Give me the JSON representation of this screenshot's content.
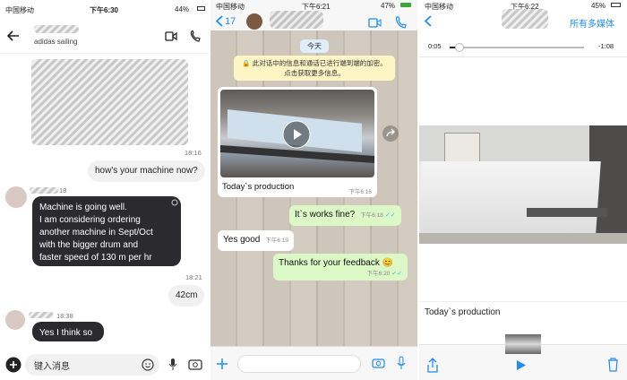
{
  "left": {
    "status": {
      "carrier": "中国移动",
      "time": "下午6:30",
      "battery": "44%"
    },
    "header": {
      "subtitle": "adidas sailing"
    },
    "messages": [
      {
        "time": "18:16"
      },
      {
        "text": "how's your machine now?"
      },
      {
        "time": "18"
      },
      {
        "lines": [
          "Machine is going well.",
          "I am considering ordering",
          "another machine in Sept/Oct",
          "with the bigger drum and",
          "faster speed of 130 m per hr"
        ]
      },
      {
        "time": "18:21"
      },
      {
        "text": "42cm"
      },
      {
        "time": "18:38"
      },
      {
        "text": "Yes I think so"
      }
    ],
    "input_placeholder": "键入消息"
  },
  "middle": {
    "status": {
      "carrier": "中国移动",
      "time": "下午6:21",
      "battery": "47%"
    },
    "header": {
      "back_count": "17"
    },
    "date_label": "今天",
    "encryption_notice": "此对话中的信息和通话已进行端到端的加密。点击获取更多信息。",
    "video_caption": "Today`s production",
    "video_time": "下午6:16",
    "messages": [
      {
        "text": "It`s works fine?",
        "time": "下午6:18",
        "dir": "out"
      },
      {
        "text": "Yes good",
        "time": "下午6:19",
        "dir": "in"
      },
      {
        "text": "Thanks for your feedback 😊",
        "time": "下午6:20",
        "dir": "out"
      }
    ]
  },
  "right": {
    "status": {
      "carrier": "中国移动",
      "time": "下午6:22",
      "battery": "45%"
    },
    "header": {
      "action": "所有多媒体"
    },
    "video": {
      "elapsed": "0:05",
      "remaining": "-1:08",
      "progress": 0.07
    },
    "caption": "Today`s production"
  },
  "colors": {
    "whatsapp_blue": "#1a8cff",
    "out_bubble": "#dcf8c6",
    "dark_bubble": "#2a2a2f"
  }
}
